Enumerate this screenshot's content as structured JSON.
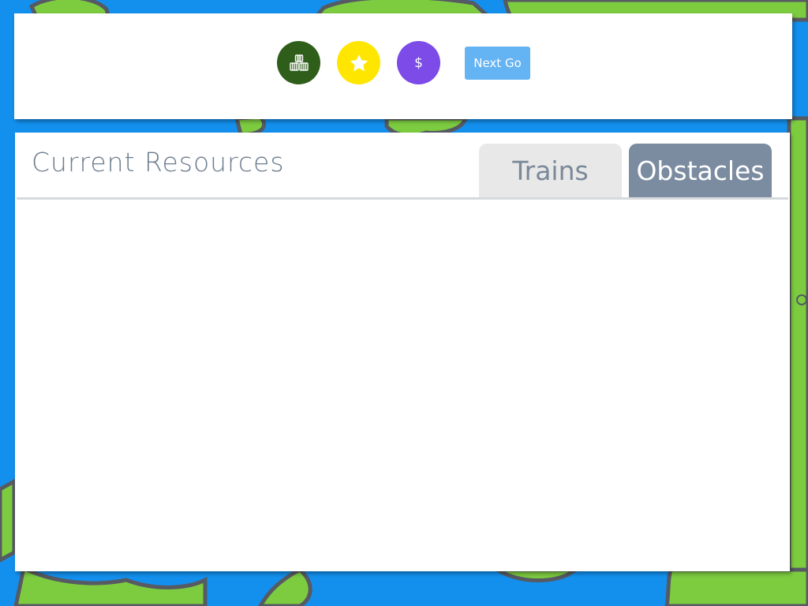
{
  "map": {
    "water_color": "#1390ee",
    "land_color": "#7dcc40",
    "border_color": "#565a63"
  },
  "toolbar": {
    "resources": [
      {
        "name": "cargo-crates-icon",
        "color": "#2e5e1a"
      },
      {
        "name": "star-icon",
        "color": "#ffe600"
      },
      {
        "name": "dollar-icon",
        "color": "#7c4be8",
        "glyph": "$"
      }
    ],
    "next_go_label": "Next Go",
    "next_go_color": "#64b3f2"
  },
  "panel": {
    "title": "Current Resources",
    "tabs": [
      {
        "label": "Trains",
        "active": false
      },
      {
        "label": "Obstacles",
        "active": true
      }
    ],
    "items": []
  }
}
